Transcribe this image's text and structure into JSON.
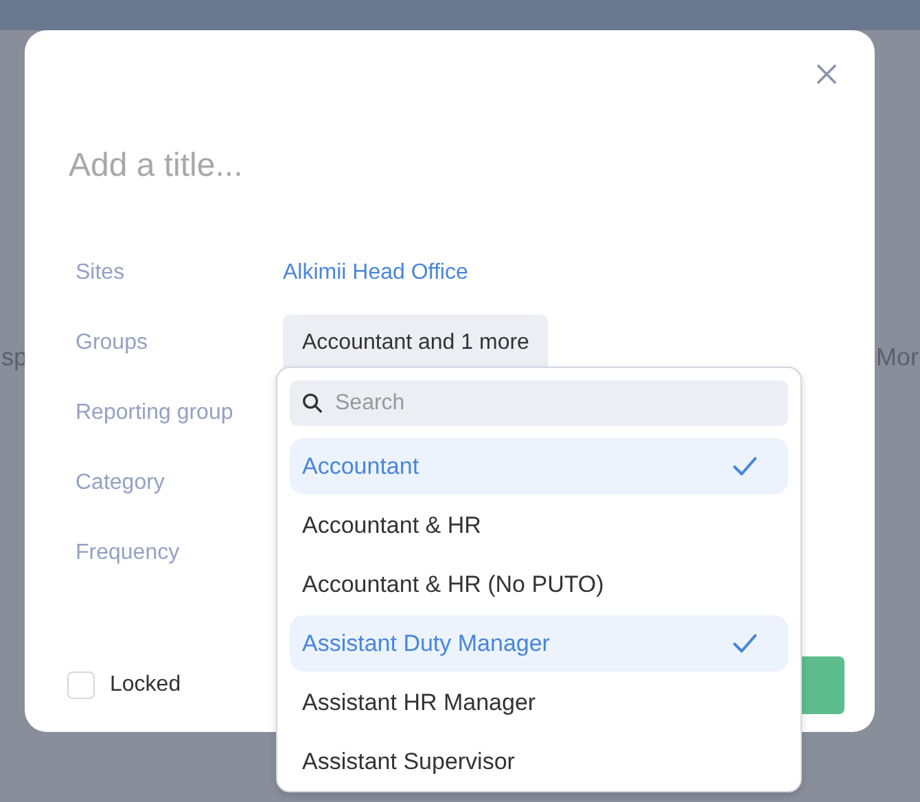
{
  "background": {
    "texts": [
      "sp",
      "Mor"
    ]
  },
  "dialog": {
    "title_placeholder": "Add a title...",
    "fields": [
      {
        "label": "Sites",
        "kind": "link",
        "value": "Alkimii Head Office"
      },
      {
        "label": "Groups",
        "kind": "select",
        "value": "Accountant and 1 more"
      },
      {
        "label": "Reporting group",
        "kind": "empty"
      },
      {
        "label": "Category",
        "kind": "empty"
      },
      {
        "label": "Frequency",
        "kind": "empty"
      }
    ],
    "locked": {
      "label": "Locked",
      "checked": false
    }
  },
  "dropdown": {
    "search_placeholder": "Search",
    "options": [
      {
        "label": "Accountant",
        "selected": true
      },
      {
        "label": "Accountant & HR",
        "selected": false
      },
      {
        "label": "Accountant & HR (No PUTO)",
        "selected": false
      },
      {
        "label": "Assistant Duty Manager",
        "selected": true
      },
      {
        "label": "Assistant HR Manager",
        "selected": false
      },
      {
        "label": "Assistant Supervisor",
        "selected": false
      }
    ]
  }
}
